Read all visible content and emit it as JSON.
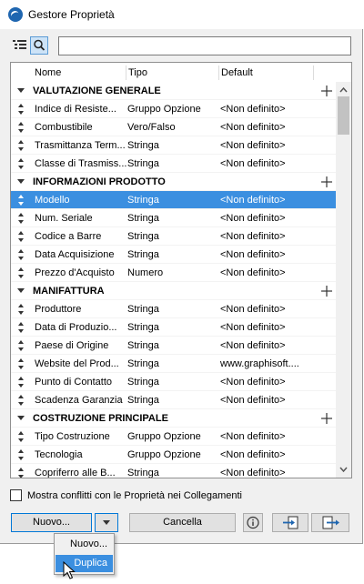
{
  "window": {
    "title": "Gestore Proprietà"
  },
  "toolbar": {
    "search_value": ""
  },
  "columns": {
    "name": "Nome",
    "type": "Tipo",
    "default": "Default"
  },
  "groups": [
    {
      "label": "VALUTAZIONE GENERALE",
      "items": [
        {
          "name": "Indice di Resiste...",
          "type": "Gruppo Opzione",
          "default": "<Non definito>"
        },
        {
          "name": "Combustibile",
          "type": "Vero/Falso",
          "default": "<Non definito>"
        },
        {
          "name": "Trasmittanza Term...",
          "type": "Stringa",
          "default": "<Non definito>"
        },
        {
          "name": "Classe di Trasmiss...",
          "type": "Stringa",
          "default": "<Non definito>"
        }
      ]
    },
    {
      "label": "INFORMAZIONI PRODOTTO",
      "items": [
        {
          "name": "Modello",
          "type": "Stringa",
          "default": "<Non definito>"
        },
        {
          "name": "Num. Seriale",
          "type": "Stringa",
          "default": "<Non definito>"
        },
        {
          "name": "Codice a Barre",
          "type": "Stringa",
          "default": "<Non definito>"
        },
        {
          "name": "Data Acquisizione",
          "type": "Stringa",
          "default": "<Non definito>"
        },
        {
          "name": "Prezzo d'Acquisto",
          "type": "Numero",
          "default": "<Non definito>"
        }
      ]
    },
    {
      "label": "MANIFATTURA",
      "items": [
        {
          "name": "Produttore",
          "type": "Stringa",
          "default": "<Non definito>"
        },
        {
          "name": "Data di Produzio...",
          "type": "Stringa",
          "default": "<Non definito>"
        },
        {
          "name": "Paese di Origine",
          "type": "Stringa",
          "default": "<Non definito>"
        },
        {
          "name": "Website del Prod...",
          "type": "Stringa",
          "default": "www.graphisoft...."
        },
        {
          "name": "Punto di Contatto",
          "type": "Stringa",
          "default": "<Non definito>"
        },
        {
          "name": "Scadenza Garanzia",
          "type": "Stringa",
          "default": "<Non definito>"
        }
      ]
    },
    {
      "label": "COSTRUZIONE PRINCIPALE",
      "items": [
        {
          "name": "Tipo Costruzione",
          "type": "Gruppo Opzione",
          "default": "<Non definito>"
        },
        {
          "name": "Tecnologia",
          "type": "Gruppo Opzione",
          "default": "<Non definito>"
        },
        {
          "name": "Copriferro alle B...",
          "type": "Stringa",
          "default": "<Non definito>"
        }
      ]
    }
  ],
  "selected_item": "Modello",
  "footer": {
    "show_conflicts_label": "Mostra conflitti con le Proprietà nei Collegamenti",
    "show_conflicts_checked": false,
    "new_label": "Nuovo...",
    "cancel_label": "Cancella"
  },
  "new_menu": {
    "items": [
      "Nuovo...",
      "Duplica"
    ],
    "highlighted": "Duplica"
  },
  "colors": {
    "selection": "#3b8fe0",
    "accent": "#0078d7"
  }
}
